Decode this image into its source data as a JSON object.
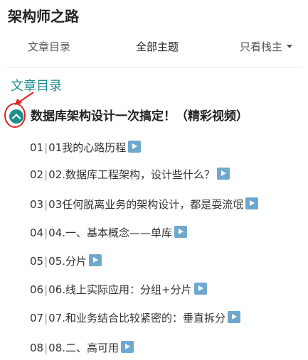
{
  "header": {
    "site_title": "架构师之路"
  },
  "tabs": [
    {
      "label": "文章目录"
    },
    {
      "label": "全部主题"
    },
    {
      "label": "只看栈主"
    }
  ],
  "section": {
    "label": "文章目录"
  },
  "chapter": {
    "title": "数据库架构设计一次搞定！（精彩视频）"
  },
  "lessons": [
    {
      "num": "01",
      "title": "01我的心路历程"
    },
    {
      "num": "02",
      "title": "02.数据库工程架构，设计些什么？"
    },
    {
      "num": "03",
      "title": "03任何脱离业务的架构设计，都是耍流氓"
    },
    {
      "num": "04",
      "title": "04.一、基本概念——单库"
    },
    {
      "num": "05",
      "title": "05.分片"
    },
    {
      "num": "06",
      "title": "06.线上实际应用：分组+分片"
    },
    {
      "num": "07",
      "title": "07.和业务结合比较紧密的：垂直拆分"
    },
    {
      "num": "08",
      "title": "08.二、高可用"
    }
  ],
  "icons": {
    "collapse": "chevron-up-icon",
    "play": "play-icon",
    "tab_dropdown": "caret-down-icon"
  },
  "colors": {
    "accent": "#1f8e8e",
    "play_badge": "#6fa8cf",
    "annotation": "#e32222"
  }
}
